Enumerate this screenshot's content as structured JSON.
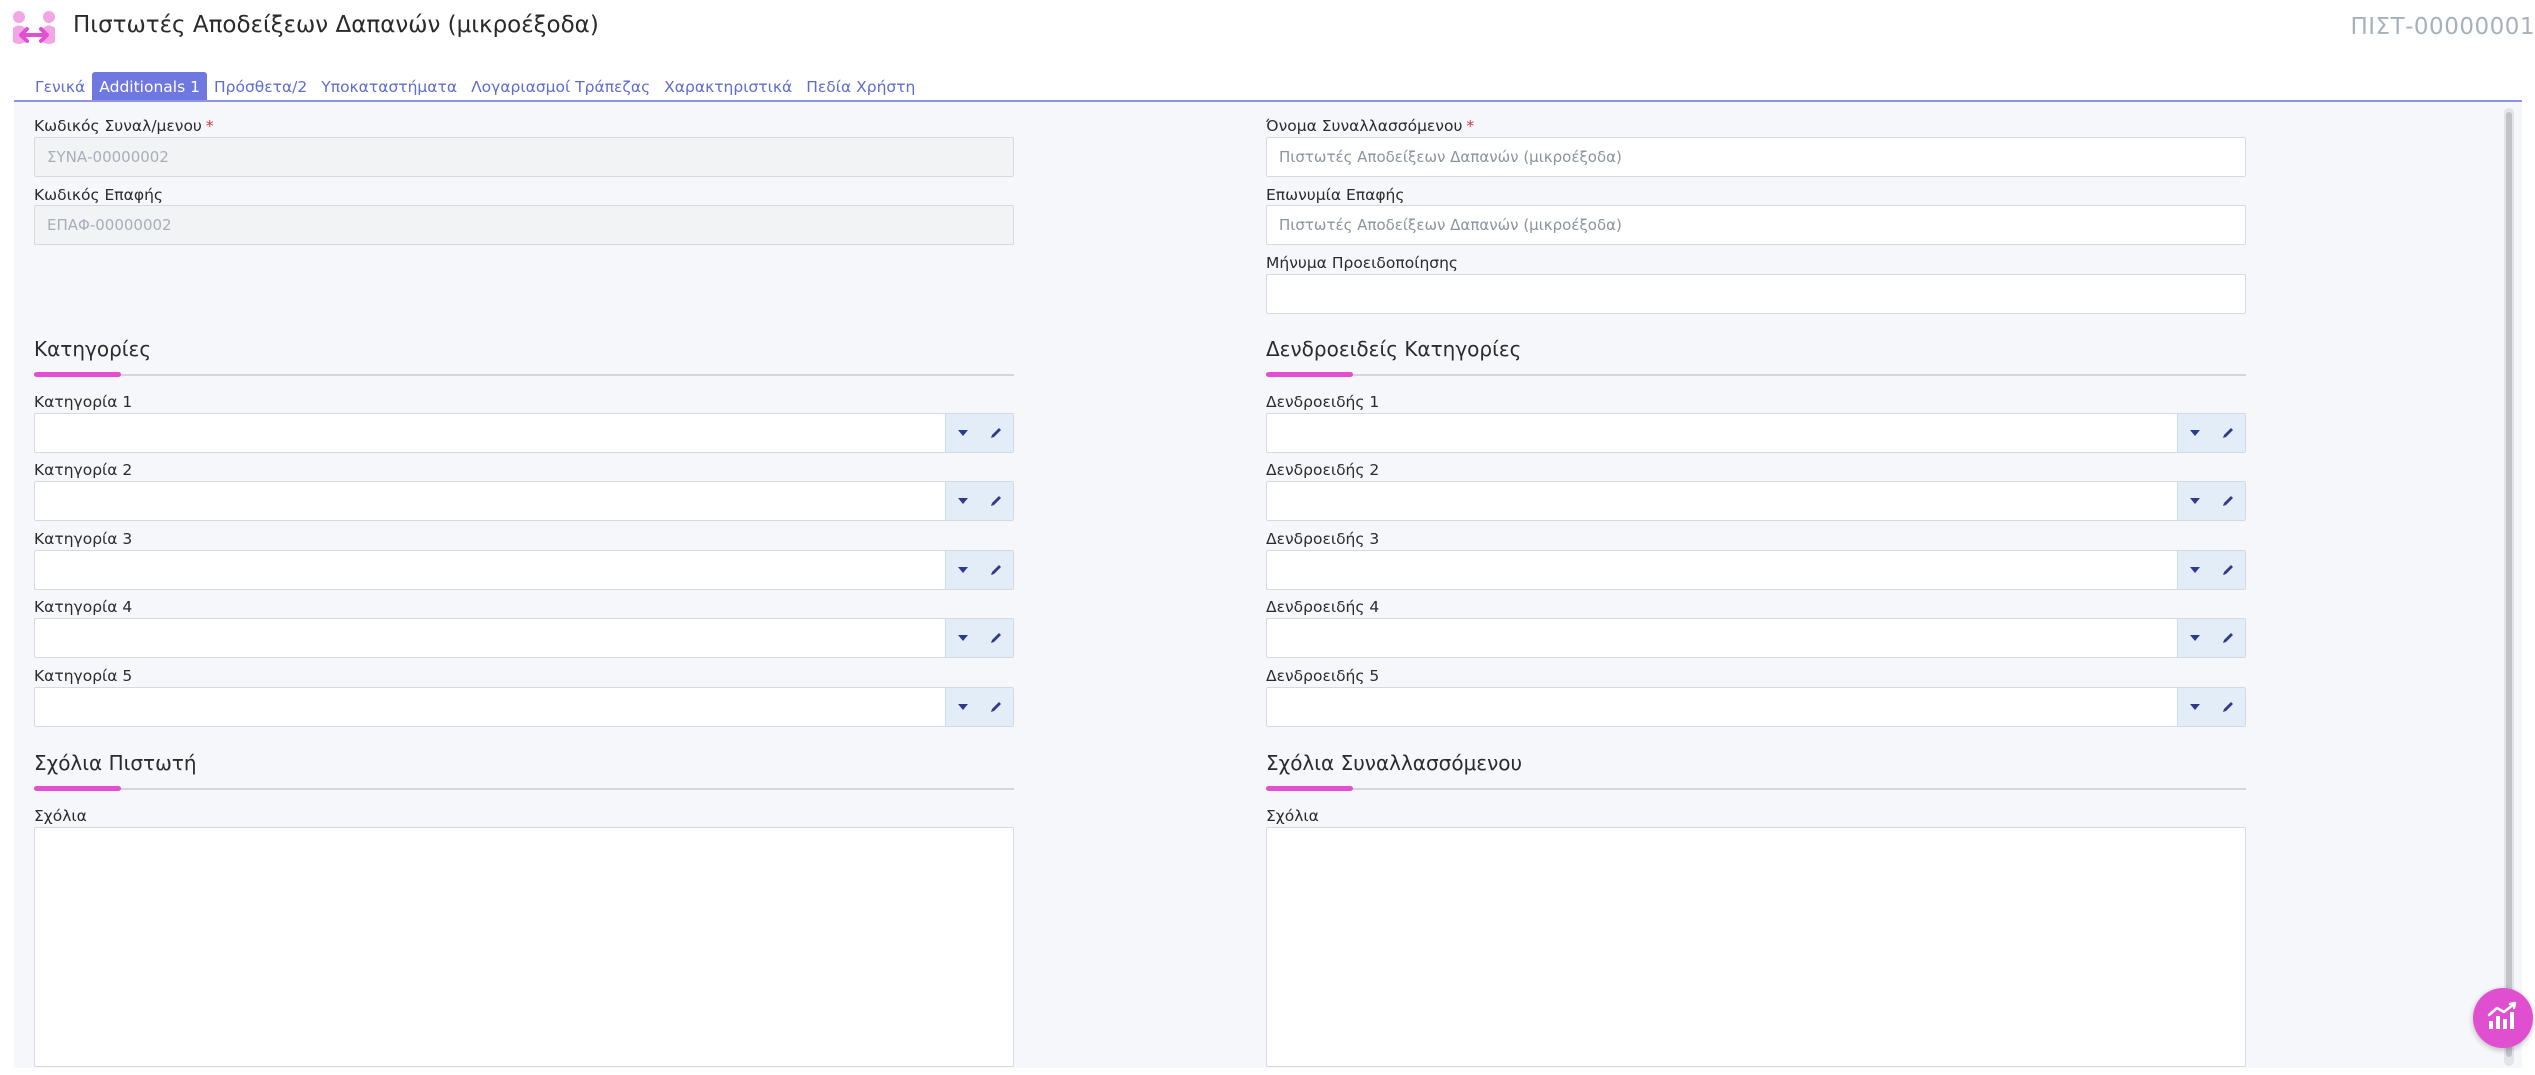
{
  "app": {
    "title": "Πιστωτές Αποδείξεων Δαπανών (μικροέξοδα)",
    "record_code": "ΠΙΣΤ-00000001",
    "accent_color": "#e24fd0",
    "primary_color": "#6f78e0"
  },
  "tabs": [
    {
      "label": "Γενικά",
      "active": false
    },
    {
      "label": "Additionals 1",
      "active": true
    },
    {
      "label": "Πρόσθετα/2",
      "active": false
    },
    {
      "label": "Υποκαταστήματα",
      "active": false
    },
    {
      "label": "Λογαριασμοί Τράπεζας",
      "active": false
    },
    {
      "label": "Χαρακτηριστικά",
      "active": false
    },
    {
      "label": "Πεδία Χρήστη",
      "active": false
    }
  ],
  "left": {
    "trader_code": {
      "label": "Κωδικός Συναλ/μενου",
      "required_mark": "*",
      "value": "ΣΥΝΑ-00000002"
    },
    "contact_code": {
      "label": "Κωδικός Επαφής",
      "value": "ΕΠΑΦ-00000002"
    },
    "categories": {
      "title": "Κατηγορίες",
      "items": [
        {
          "label": "Κατηγορία 1",
          "value": ""
        },
        {
          "label": "Κατηγορία 2",
          "value": ""
        },
        {
          "label": "Κατηγορία 3",
          "value": ""
        },
        {
          "label": "Κατηγορία 4",
          "value": ""
        },
        {
          "label": "Κατηγορία 5",
          "value": ""
        }
      ]
    },
    "comments": {
      "title": "Σχόλια Πιστωτή",
      "label": "Σχόλια",
      "value": ""
    }
  },
  "right": {
    "trader_name": {
      "label": "Όνομα Συναλλασσόμενου",
      "required_mark": "*",
      "value": "Πιστωτές Αποδείξεων Δαπανών (μικροέξοδα)"
    },
    "contact_name": {
      "label": "Επωνυμία Επαφής",
      "value": "Πιστωτές Αποδείξεων Δαπανών (μικροέξοδα)"
    },
    "warning_message": {
      "label": "Μήνυμα Προειδοποίησης",
      "value": ""
    },
    "tree_categories": {
      "title": "Δενδροειδείς Κατηγορίες",
      "items": [
        {
          "label": "Δενδροειδής 1",
          "value": ""
        },
        {
          "label": "Δενδροειδής 2",
          "value": ""
        },
        {
          "label": "Δενδροειδής 3",
          "value": ""
        },
        {
          "label": "Δενδροειδής 4",
          "value": ""
        },
        {
          "label": "Δενδροειδής 5",
          "value": ""
        }
      ]
    },
    "comments": {
      "title": "Σχόλια Συναλλασσόμενου",
      "label": "Σχόλια",
      "value": ""
    }
  },
  "icons": {
    "logo": "handshake-logo-icon",
    "dropdown": "caret-down-icon",
    "edit": "pencil-icon",
    "fab": "chart-line-icon"
  }
}
